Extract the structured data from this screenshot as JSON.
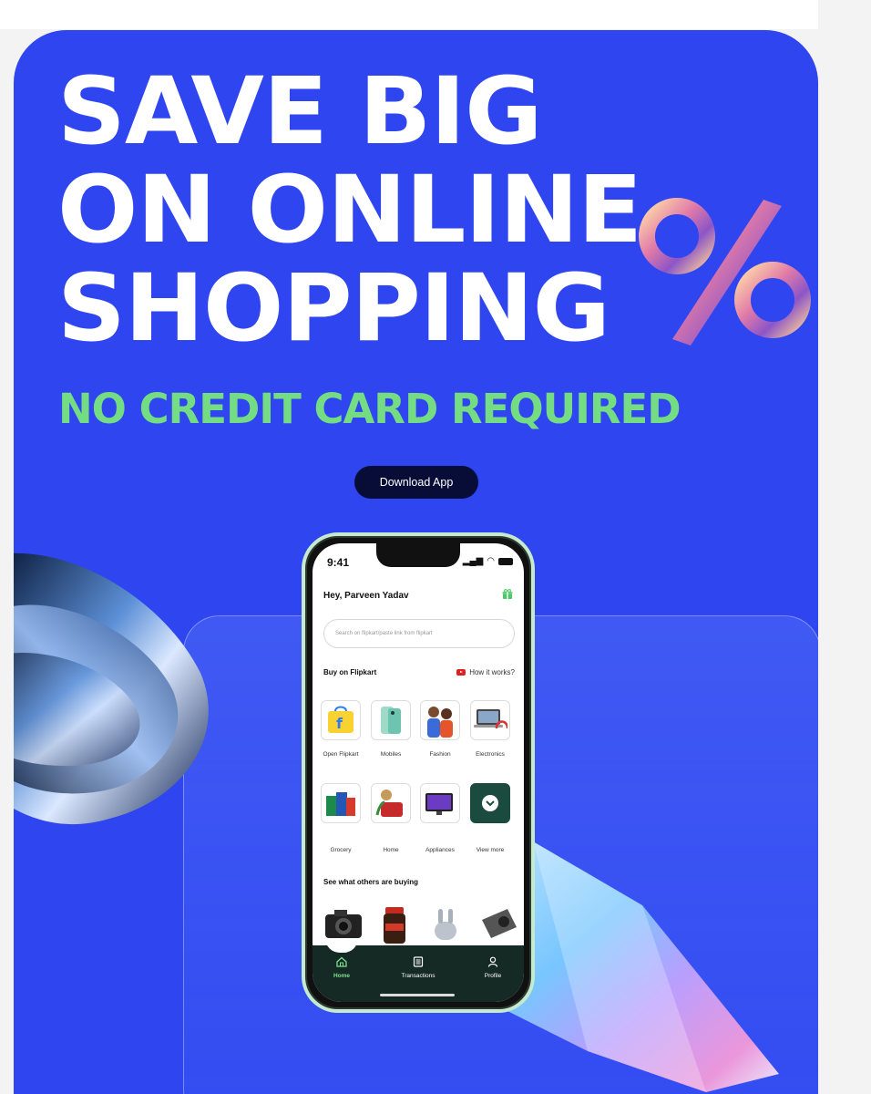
{
  "hero": {
    "headline_lines": [
      "SAVE BIG",
      "ON ONLINE",
      "SHOPPING"
    ],
    "subheadline": "NO CREDIT CARD REQUIRED",
    "cta_label": "Download App"
  },
  "colors": {
    "hero_bg": "#2e45f0",
    "headline": "#ffffff",
    "subheadline": "#74dd83",
    "cta_bg": "#070d36",
    "app_nav_bg": "#152a25",
    "app_nav_active": "#7be38a"
  },
  "phone": {
    "status_time": "9:41",
    "greeting": "Hey, Parveen Yadav",
    "search_placeholder": "Search on flipkart/paste link from flipkart",
    "buy_section_title": "Buy on Flipkart",
    "how_it_works_label": "How it works?",
    "categories": [
      {
        "label": "Open Flipkart",
        "icon": "flipkart-bag-icon"
      },
      {
        "label": "Mobiles",
        "icon": "mobile-phone-icon"
      },
      {
        "label": "Fashion",
        "icon": "fashion-people-icon"
      },
      {
        "label": "Electronics",
        "icon": "laptop-headphones-icon"
      },
      {
        "label": "Grocery",
        "icon": "grocery-icon"
      },
      {
        "label": "Home",
        "icon": "home-furniture-icon"
      },
      {
        "label": "Appliances",
        "icon": "appliances-icon"
      },
      {
        "label": "View more",
        "icon": "chevron-down-icon"
      }
    ],
    "others_title": "See what others are buying",
    "products": [
      "camera-icon",
      "coffee-jar-icon",
      "earbuds-icon",
      "projector-icon"
    ],
    "nav": [
      {
        "label": "Home",
        "icon": "home-icon",
        "active": true
      },
      {
        "label": "Transactions",
        "icon": "list-icon",
        "active": false
      },
      {
        "label": "Profile",
        "icon": "user-icon",
        "active": false
      }
    ]
  }
}
